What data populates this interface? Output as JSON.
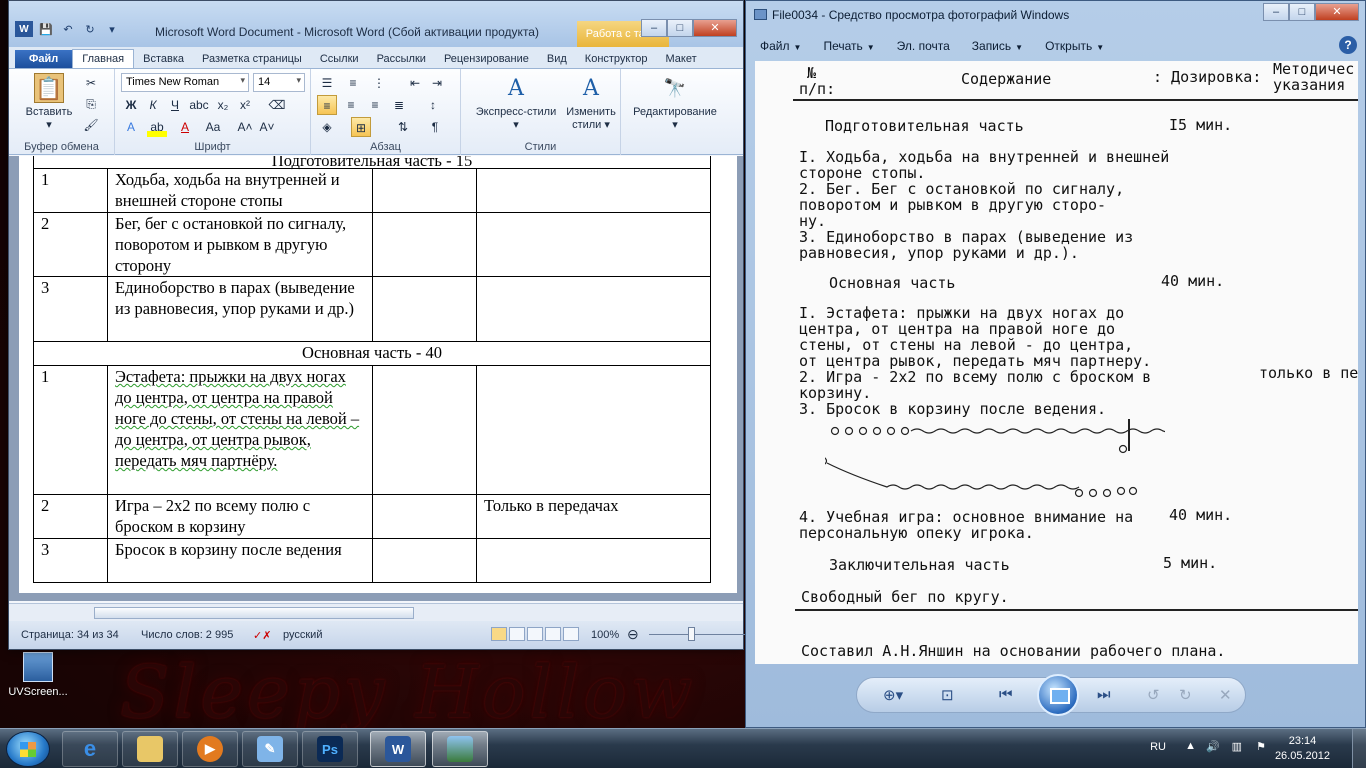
{
  "word": {
    "title": "Microsoft Word Document  -  Microsoft Word (Сбой активации продукта)",
    "context_tab": "Работа с таб...",
    "tabs": [
      "Файл",
      "Главная",
      "Вставка",
      "Разметка страницы",
      "Ссылки",
      "Рассылки",
      "Рецензирование",
      "Вид",
      "Конструктор",
      "Макет"
    ],
    "active_tab": "Главная",
    "ribbon": {
      "paste_label": "Вставить",
      "font_name": "Times New Roman",
      "font_size": "14",
      "styles_quick": "Экспресс-стили",
      "styles_change": "Изменить стили",
      "editing": "Редактирование",
      "groups": {
        "clipboard": "Буфер обмена",
        "font": "Шрифт",
        "paragraph": "Абзац",
        "styles": "Стили"
      }
    },
    "table": {
      "top_partial": "Подготовительная  часть - 15",
      "rows": [
        {
          "n": "1",
          "text": "Ходьба, ходьба на внутренней и внешней стороне стопы",
          "c3": "",
          "c4": ""
        },
        {
          "n": "2",
          "text": "Бег, бег с остановкой по сигналу, поворотом и рывком в другую сторону",
          "c3": "",
          "c4": ""
        },
        {
          "n": "3",
          "text": "Единоборство в парах (выведение из равновесия, упор руками и др.)",
          "c3": "",
          "c4": ""
        }
      ],
      "section_main": "Основная часть - 40",
      "rows2": [
        {
          "n": "1",
          "text": "Эстафета: прыжки на двух ногах до центра, от центра на правой ноге до стены, от стены на левой – до центра, от центра рывок, передать мяч партнёру.",
          "c3": "",
          "c4": ""
        },
        {
          "n": "2",
          "text": "Игра – 2х2 по всему полю с броском в корзину",
          "c3": "",
          "c4": "Только в передачах"
        },
        {
          "n": "3",
          "text": "Бросок в корзину после ведения",
          "c3": "",
          "c4": ""
        }
      ]
    },
    "status": {
      "page": "Страница: 34 из 34",
      "words": "Число слов: 2 995",
      "lang": "русский",
      "zoom": "100%"
    }
  },
  "viewer": {
    "title": "File0034 - Средство просмотра фотографий Windows",
    "menu": [
      "Файл",
      "Печать",
      "Эл. почта",
      "Запись",
      "Открыть"
    ],
    "scan": {
      "h_num": "№",
      "h_pp": "п/п:",
      "h_content": "Содержание",
      "h_dose": ": Дозировка:",
      "h_method": "Методичес",
      "h_method2": "указания",
      "prep": "Подготовительная часть",
      "prep_t": "I5 мин.",
      "i1a": "I. Ходьба, ходьба на внутренней и внешней",
      "i1b": "   стороне стопы.",
      "i2a": "2. Бег. Бег с остановкой по сигналу,",
      "i2b": "   поворотом и рывком в другую сторо-",
      "i2c": "   ну.",
      "i3a": "3. Единоборство в парах (выведение из",
      "i3b": "   равновесия, упор руками и др.).",
      "main": "Основная часть",
      "main_t": "40 мин.",
      "m1a": "I. Эстафета: прыжки на двух ногах до",
      "m1b": "   центра, от центра на правой ноге до",
      "m1c": "   стены, от стены на левой - до центра,",
      "m1d": "   от центра рывок, передать мяч партнеру.",
      "m2a": "2. Игра - 2х2 по всему полю с броском в",
      "m2note": "только в пе",
      "m2b": "   корзину.",
      "m3": "3. Бросок в корзину после ведения.",
      "m4a": "4. Учебная игра: основное внимание на",
      "m4t": "40 мин.",
      "m4b": "   персональную опеку игрока.",
      "final": "Заключительная часть",
      "final_t": "5 мин.",
      "run": "Свободный бег по кругу.",
      "author": "Составил  А.Н.Яншин на основании рабочего плана."
    }
  },
  "desktop": {
    "icon_label": "UVScreen...",
    "wallpaper_text": "Sleepy Hollow"
  },
  "taskbar": {
    "lang": "RU",
    "time": "23:14",
    "date": "26.05.2012",
    "apps": [
      "ie",
      "explorer",
      "media-player",
      "paint",
      "photoshop",
      "word",
      "photo-viewer"
    ]
  }
}
